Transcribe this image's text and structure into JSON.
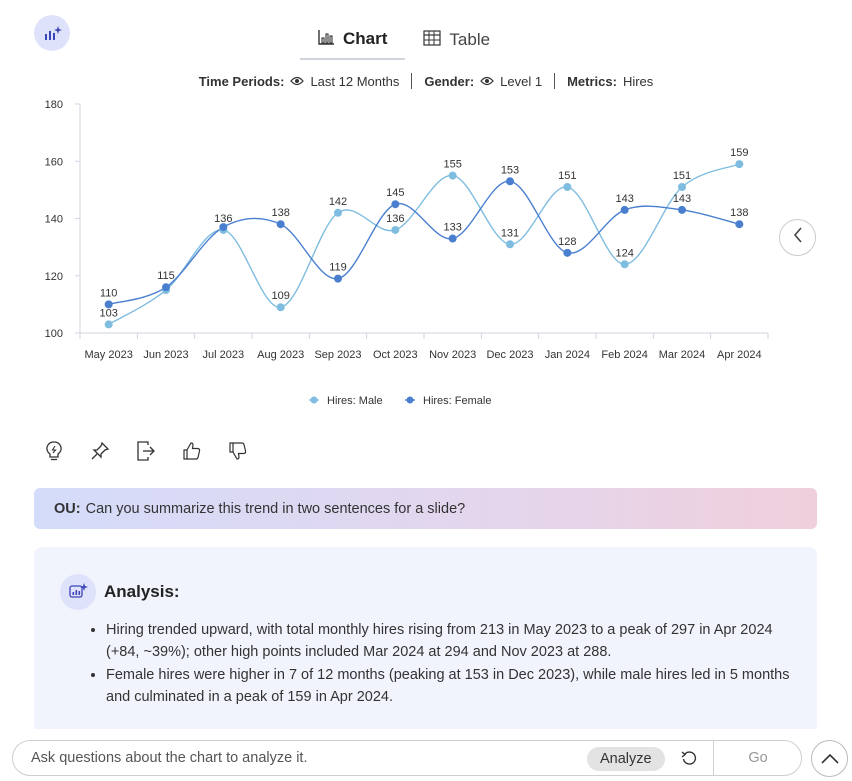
{
  "tabs": [
    {
      "label": "Chart",
      "icon": "bar-chart-icon",
      "active": true
    },
    {
      "label": "Table",
      "icon": "table-icon",
      "active": false
    }
  ],
  "filters": {
    "time_label": "Time Periods:",
    "time_value": "Last 12 Months",
    "gender_label": "Gender:",
    "gender_value": "Level 1",
    "metrics_label": "Metrics:",
    "metrics_value": "Hires"
  },
  "chart_data": {
    "type": "line",
    "categories": [
      "May 2023",
      "Jun 2023",
      "Jul 2023",
      "Aug 2023",
      "Sep 2023",
      "Oct 2023",
      "Nov 2023",
      "Dec 2023",
      "Jan 2024",
      "Feb 2024",
      "Mar 2024",
      "Apr 2024"
    ],
    "series": [
      {
        "name": "Hires: Male",
        "color": "#7fbde0",
        "values": [
          103,
          115,
          136,
          109,
          142,
          136,
          155,
          131,
          151,
          124,
          151,
          159
        ]
      },
      {
        "name": "Hires: Female",
        "color": "#4a7fd0",
        "values": [
          110,
          116,
          137,
          138,
          119,
          145,
          133,
          153,
          128,
          143,
          143,
          138
        ]
      }
    ],
    "value_labels": {
      "Hires: Male": [
        "103",
        "",
        "136",
        "109",
        "142",
        "136",
        "155",
        "131",
        "151",
        "124",
        "151",
        "159"
      ],
      "Hires: Female": [
        "110",
        "115",
        "",
        "138",
        "119",
        "145",
        "133",
        "153",
        "128",
        "143",
        "143",
        "138"
      ]
    },
    "ylim": [
      100,
      180
    ],
    "yticks": [
      100,
      120,
      140,
      160,
      180
    ],
    "legend": "bottom",
    "grid": false
  },
  "question": {
    "who": "OU:",
    "text": "Can you summarize this trend in two sentences for a slide?"
  },
  "analysis": {
    "title": "Analysis:",
    "points": [
      "Hiring trended upward, with total monthly hires rising from 213 in May 2023 to a peak of 297 in Apr 2024 (+84, ~39%); other high points included Mar 2024 at 294 and Nov 2023 at 288.",
      "Female hires were higher in 7 of 12 months (peaking at 153 in Dec 2023), while male hires led in 5 months and culminated in a peak of 159 in Apr 2024."
    ]
  },
  "input": {
    "placeholder": "Ask questions about the chart to analyze it.",
    "value": ""
  },
  "buttons": {
    "analyze": "Analyze",
    "go": "Go"
  }
}
